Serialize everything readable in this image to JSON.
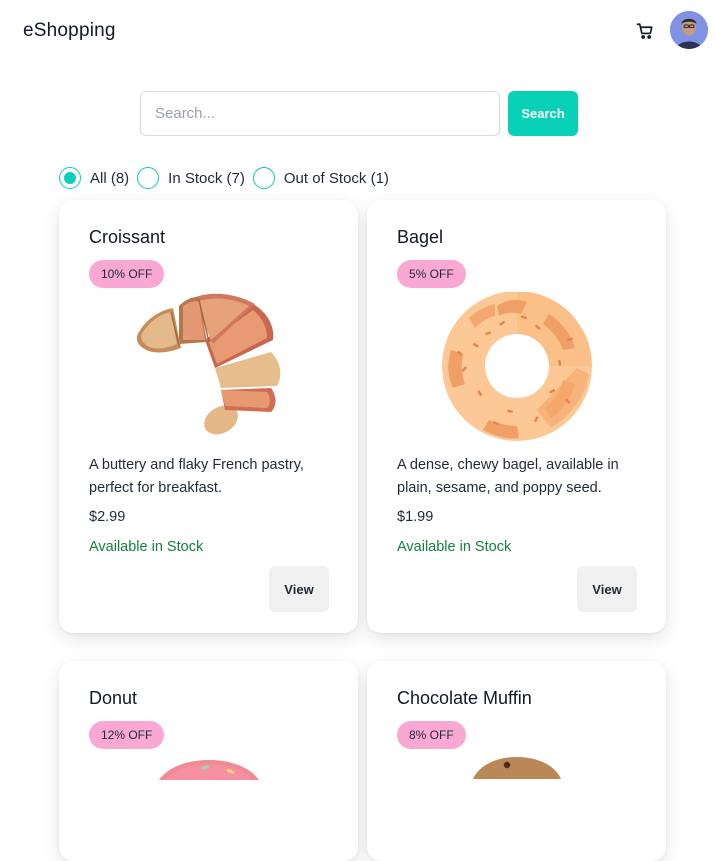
{
  "header": {
    "brand": "eShopping",
    "cart_icon": "shopping-cart-icon",
    "avatar_icon": "user-avatar"
  },
  "search": {
    "placeholder": "Search...",
    "value": "",
    "button_label": "Search"
  },
  "filters": [
    {
      "label": "All (8)",
      "checked": true
    },
    {
      "label": "In Stock (7)",
      "checked": false
    },
    {
      "label": "Out of Stock (1)",
      "checked": false
    }
  ],
  "products": [
    {
      "name": "Croissant",
      "discount": "10% OFF",
      "image_icon": "croissant-icon",
      "description": "A buttery and flaky French pastry, perfect for breakfast.",
      "price": "$2.99",
      "stock": "Available in Stock",
      "button": "View"
    },
    {
      "name": "Bagel",
      "discount": "5% OFF",
      "image_icon": "bagel-icon",
      "description": "A dense, chewy bagel, available in plain, sesame, and poppy seed.",
      "price": "$1.99",
      "stock": "Available in Stock",
      "button": "View"
    },
    {
      "name": "Donut",
      "discount": "12% OFF",
      "image_icon": "donut-icon"
    },
    {
      "name": "Chocolate Muffin",
      "discount": "8% OFF",
      "image_icon": "muffin-icon"
    }
  ],
  "colors": {
    "accent": "#08d1b8",
    "badge": "#f9a8d4",
    "in_stock": "#15803d",
    "view_button_bg": "#f0f0f0"
  }
}
